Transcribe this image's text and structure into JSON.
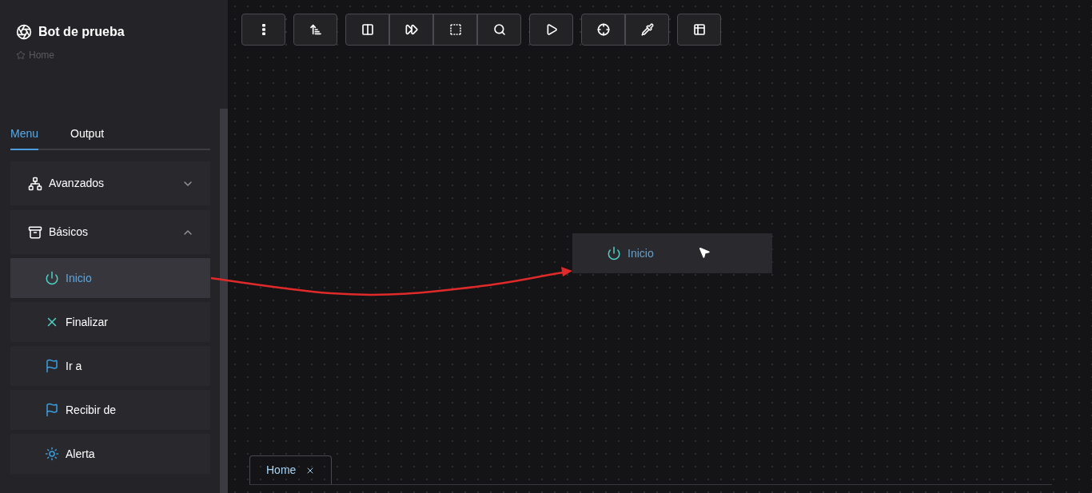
{
  "sidebar": {
    "title": "Bot de prueba",
    "breadcrumb": "Home",
    "tabs": [
      {
        "label": "Menu",
        "selected": true
      },
      {
        "label": "Output",
        "selected": false
      }
    ],
    "groups": [
      {
        "label": "Avanzados",
        "kind": "nodes",
        "expanded": false
      },
      {
        "label": "Básicos",
        "kind": "archive",
        "expanded": true,
        "items": [
          {
            "label": "Inicio",
            "kind": "power",
            "selected": true
          },
          {
            "label": "Finalizar",
            "kind": "close",
            "selected": false
          },
          {
            "label": "Ir a",
            "kind": "flag",
            "selected": false
          },
          {
            "label": "Recibir de",
            "kind": "flag",
            "selected": false
          },
          {
            "label": "Alerta",
            "kind": "sun",
            "selected": false
          }
        ]
      }
    ]
  },
  "canvas": {
    "nodes": [
      {
        "label": "Inicio",
        "kind": "power"
      }
    ]
  },
  "bottom_tabs": [
    {
      "label": "Home",
      "selected": true
    }
  ]
}
